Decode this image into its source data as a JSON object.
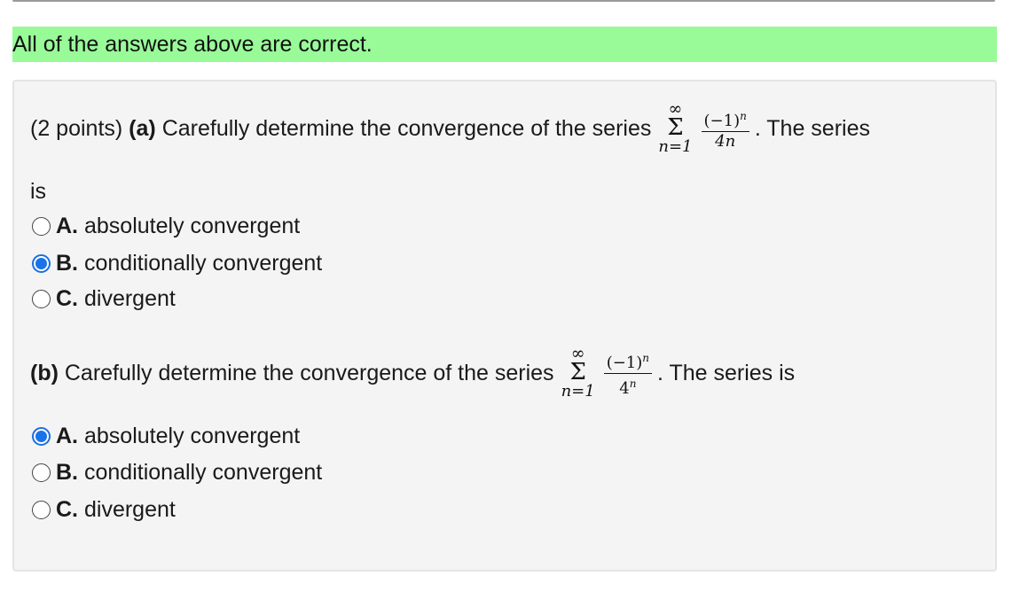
{
  "banner": {
    "text": "All of the answers above are correct."
  },
  "part_a": {
    "points": "(2 points)",
    "label": "(a)",
    "prompt": "Carefully determine the convergence of the series",
    "sum_upper": "∞",
    "sum_symbol": "Σ",
    "sum_lower": "n=1",
    "numerator_base": "(−1)",
    "numerator_exp": "n",
    "denominator": "4n",
    "after": ". The series",
    "continuation": "is",
    "options": [
      {
        "letter": "A.",
        "text": "absolutely convergent",
        "selected": false
      },
      {
        "letter": "B.",
        "text": "conditionally convergent",
        "selected": true
      },
      {
        "letter": "C.",
        "text": "divergent",
        "selected": false
      }
    ]
  },
  "part_b": {
    "label": "(b)",
    "prompt": "Carefully determine the convergence of the series",
    "sum_upper": "∞",
    "sum_symbol": "Σ",
    "sum_lower": "n=1",
    "numerator_base": "(−1)",
    "numerator_exp": "n",
    "denominator_base": "4",
    "denominator_exp": "n",
    "after": ". The series is",
    "options": [
      {
        "letter": "A.",
        "text": "absolutely convergent",
        "selected": true
      },
      {
        "letter": "B.",
        "text": "conditionally convergent",
        "selected": false
      },
      {
        "letter": "C.",
        "text": "divergent",
        "selected": false
      }
    ]
  }
}
